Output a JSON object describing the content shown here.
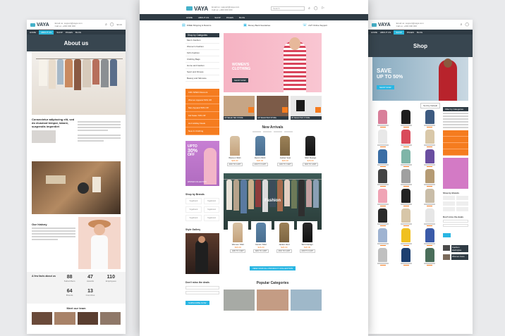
{
  "brand": "VAYA",
  "contact": {
    "email": "Email us: support@vaya.com",
    "phone": "Call us: +000 000 000"
  },
  "cart": "$0.00",
  "search": {
    "placeholder": "Search"
  },
  "nav": {
    "items": [
      "HOME",
      "ABOUT US",
      "SHOP",
      "PAGES",
      "BLOG"
    ]
  },
  "about": {
    "title": "About us",
    "heading": "Consectetur adipiscing elit, sed do eiusmod tempor, labore, suspendis imperdiet",
    "history_title": "Our history",
    "facts_title": "A few facts about us",
    "facts": [
      {
        "n": "88",
        "l": "Subscribers"
      },
      {
        "n": "47",
        "l": "Awards"
      },
      {
        "n": "110",
        "l": "Employees"
      },
      {
        "n": "64",
        "l": "Brands"
      },
      {
        "n": "13",
        "l": "Countries"
      }
    ],
    "team_title": "Meet our team"
  },
  "home": {
    "features": [
      "FREE Shipping & Returns",
      "Money Back Guarantee",
      "24/7 Online Support"
    ],
    "categories_title": "Shop by Categories",
    "categories": [
      "Men's Fashion",
      "Women's Fashion",
      "Kid's Fashion",
      "Clothing Bags",
      "Home and Garden",
      "Sport and Fitness",
      "Beauty and Skincare"
    ],
    "offers": [
      "Fifth SPED Discount",
      "Women Apparel 50% Off",
      "Men Apparel 50% Off",
      "Kid Sales 70% Off",
      "Hot Holiday Deals",
      "New In Clothing"
    ],
    "hero": {
      "title": "WOMEN'S CLOTHING",
      "button": "SHOP NOW"
    },
    "promo_labels": [
      "UP SELECTED STORE",
      "UP SELECTED STORE",
      "UP SELECTED STORE"
    ],
    "side_banner": {
      "line1": "UPTO",
      "line2": "30%",
      "line3": "OFF",
      "sub": "WINTER COLLECTION"
    },
    "new_arrivals_title": "New Arrivals",
    "new_arrivals": [
      {
        "name": "Women Shirt",
        "price": "$26.00"
      },
      {
        "name": "Denim Shirt",
        "price": "$26.00"
      },
      {
        "name": "Jacket Vest",
        "price": "$26.00"
      },
      {
        "name": "Shirt Design",
        "price": "$26.00"
      }
    ],
    "brands_title": "Shop by Brands",
    "brands": [
      "Yogabrand",
      "Yogabrand",
      "Yogabrand",
      "Yogabrand",
      "Yogabrand",
      "Yogabrand"
    ],
    "gallery_title": "Style Gallery",
    "fashion_title": "Fashion",
    "fashion_products": [
      {
        "name": "Women Shirt",
        "price": "$26.00"
      },
      {
        "name": "Denim Shirt",
        "price": "$26.00"
      },
      {
        "name": "Jacket Vest",
        "price": "$26.00"
      },
      {
        "name": "Shirt Design",
        "price": "$26.00"
      }
    ],
    "view_all": "VIEW NOW ALL PRODUCT COLLECTION",
    "newsletter_title": "Don't miss the deals",
    "newsletter_button": "SUBSCRIBE NOW",
    "popular_title": "Popular Categories",
    "add_to_cart": "ADD TO CART"
  },
  "shop": {
    "title": "Shop",
    "banner": {
      "line1": "SAVE",
      "line2": "UP TO 50%",
      "button": "SHOP NOW"
    },
    "sort": "Sort by Default",
    "filter_title": "Filter by Categories",
    "brands_title": "Shop by Brands",
    "newsletter_title": "Don't miss the deals",
    "widgets": [
      "Fashion Hairstyles",
      "Women Care"
    ]
  },
  "colors": {
    "accent": "#29b6e3",
    "orange": "#f57c1f",
    "dark": "#2f3b44",
    "pink": "#f7a7b8"
  }
}
